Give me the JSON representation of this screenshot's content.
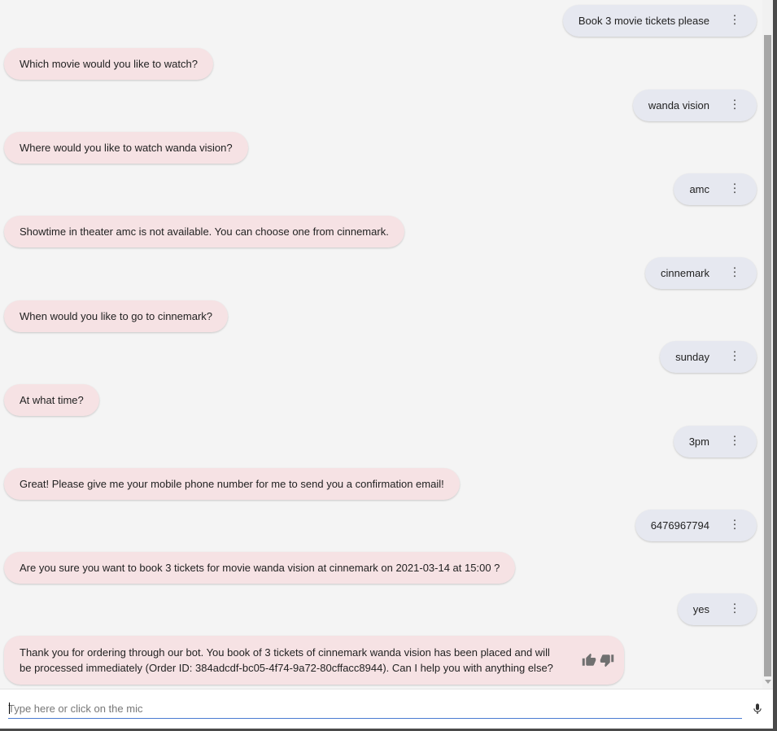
{
  "conversation": [
    {
      "role": "user",
      "text": "Book 3 movie tickets please"
    },
    {
      "role": "bot",
      "text": "Which movie would you like to watch?"
    },
    {
      "role": "user",
      "text": "wanda vision"
    },
    {
      "role": "bot",
      "text": "Where would you like to watch wanda vision?"
    },
    {
      "role": "user",
      "text": "amc"
    },
    {
      "role": "bot",
      "text": "Showtime in theater amc is not available. You can choose one from cinnemark."
    },
    {
      "role": "user",
      "text": "cinnemark"
    },
    {
      "role": "bot",
      "text": "When would you like to go to cinnemark?"
    },
    {
      "role": "user",
      "text": "sunday"
    },
    {
      "role": "bot",
      "text": "At what time?"
    },
    {
      "role": "user",
      "text": "3pm"
    },
    {
      "role": "bot",
      "text": "Great! Please give me your mobile phone number for me to send you a confirmation email!"
    },
    {
      "role": "user",
      "text": "6476967794"
    },
    {
      "role": "bot",
      "text": "Are you sure you want to book 3 tickets for movie wanda vision at cinnemark on 2021-03-14 at 15:00 ?"
    },
    {
      "role": "user",
      "text": "yes"
    },
    {
      "role": "bot",
      "text": "Thank you for ordering through our bot. You book of 3 tickets of cinnemark wanda vision has been placed and will be processed immediately (Order ID: 384adcdf-bc05-4f74-9a72-80cffacc8944). Can I help you with anything else?"
    }
  ],
  "icons": {
    "message_menu": "more-vert-icon",
    "feedback_positive": "thumb-up-icon",
    "feedback_negative": "thumb-down-icon",
    "mic": "mic-icon"
  },
  "input": {
    "value": "",
    "placeholder": "Type here or click on the mic"
  },
  "colors": {
    "bot_bubble": "#f6e2e4",
    "user_bubble": "#e6e8f0",
    "input_underline": "#4a7bd2"
  }
}
